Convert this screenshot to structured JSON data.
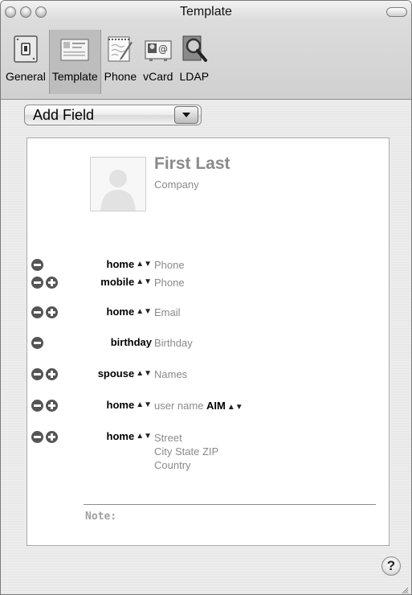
{
  "window": {
    "title": "Template"
  },
  "toolbar": {
    "items": [
      {
        "label": "General",
        "icon": "light-switch-icon",
        "selected": false
      },
      {
        "label": "Template",
        "icon": "template-card-icon",
        "selected": true
      },
      {
        "label": "Phone",
        "icon": "notepad-pen-icon",
        "selected": false
      },
      {
        "label": "vCard",
        "icon": "vcard-icon",
        "selected": false
      },
      {
        "label": "LDAP",
        "icon": "magnifier-icon",
        "selected": false
      }
    ]
  },
  "add_field": {
    "label": "Add Field"
  },
  "card": {
    "name": "First Last",
    "company": "Company",
    "fields": [
      {
        "label": "home",
        "stepper": true,
        "value": "Phone",
        "buttons": [
          "remove"
        ]
      },
      {
        "label": "mobile",
        "stepper": true,
        "value": "Phone",
        "buttons": [
          "remove",
          "add"
        ]
      },
      {
        "label": "home",
        "stepper": true,
        "value": "Email",
        "buttons": [
          "remove",
          "add"
        ]
      },
      {
        "label": "birthday",
        "stepper": false,
        "value": "Birthday",
        "buttons": [
          "remove"
        ]
      },
      {
        "label": "spouse",
        "stepper": true,
        "value": "Names",
        "buttons": [
          "remove",
          "add"
        ]
      },
      {
        "label": "home",
        "stepper": true,
        "value": "user name",
        "service": "AIM",
        "buttons": [
          "remove",
          "add"
        ]
      },
      {
        "label": "home",
        "stepper": true,
        "address": [
          "Street",
          "City State ZIP",
          "Country"
        ],
        "buttons": [
          "remove",
          "add"
        ]
      }
    ],
    "note_label": "Note:"
  },
  "help": {
    "label": "?"
  },
  "colors": {
    "placeholder": "#8a8a8a",
    "selected_tab": "#bdbdbd",
    "row_button": "#555555"
  }
}
